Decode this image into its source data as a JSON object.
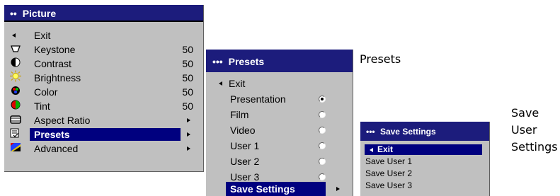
{
  "picture_menu": {
    "title": "Picture",
    "items": [
      {
        "label": "Exit",
        "icon": "back-arrow-icon"
      },
      {
        "label": "Keystone",
        "value": "50",
        "icon": "keystone-icon"
      },
      {
        "label": "Contrast",
        "value": "50",
        "icon": "contrast-icon"
      },
      {
        "label": "Brightness",
        "value": "50",
        "icon": "brightness-icon"
      },
      {
        "label": "Color",
        "value": "50",
        "icon": "color-icon"
      },
      {
        "label": "Tint",
        "value": "50",
        "icon": "tint-icon"
      },
      {
        "label": "Aspect Ratio",
        "icon": "aspect-ratio-icon"
      },
      {
        "label": "Presets",
        "icon": "presets-icon",
        "selected": true
      },
      {
        "label": "Advanced",
        "icon": "advanced-icon"
      }
    ]
  },
  "presets_menu": {
    "title": "Presets",
    "caption": "Presets",
    "items": [
      {
        "label": "Exit"
      },
      {
        "label": "Presentation",
        "radio": true,
        "checked": true
      },
      {
        "label": "Film",
        "radio": true
      },
      {
        "label": "Video",
        "radio": true
      },
      {
        "label": "User 1",
        "radio": true
      },
      {
        "label": "User 2",
        "radio": true
      },
      {
        "label": "User 3",
        "radio": true
      },
      {
        "label": "Save Settings",
        "selected": true
      }
    ]
  },
  "save_menu": {
    "title": "Save Settings",
    "caption_lines": [
      "Save",
      "User",
      "Settings"
    ],
    "items": [
      {
        "label": "Exit",
        "selected": true
      },
      {
        "label": "Save User 1"
      },
      {
        "label": "Save User 2"
      },
      {
        "label": "Save User 3"
      }
    ]
  },
  "colors": {
    "title_bg": "#1c1c7c",
    "highlight": "#00007f",
    "menu_bg": "#c0c0c0"
  }
}
